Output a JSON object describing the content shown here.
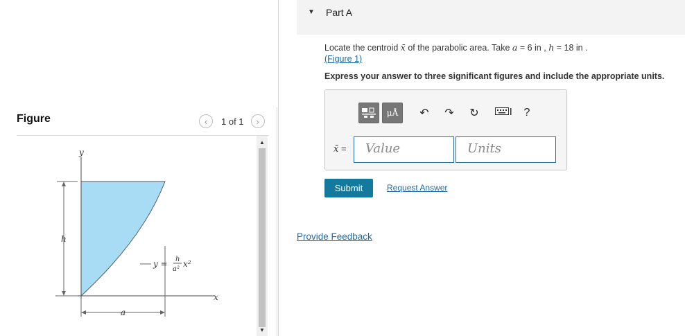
{
  "figure_panel": {
    "title": "Figure",
    "pager_text": "1 of 1",
    "labels": {
      "y_axis": "y",
      "x_axis": "x",
      "h": "h",
      "a": "a",
      "eq_y": "y =",
      "eq_h": "h",
      "eq_a2": "a²",
      "eq_x2": "x²"
    }
  },
  "part": {
    "title": "Part A"
  },
  "question": {
    "text_before": "Locate the centroid ",
    "xbar": "x̄",
    "text_mid": " of the parabolic area. Take ",
    "a_var": "a",
    "a_val": " = 6 in",
    "sep": " , ",
    "h_var": "h",
    "h_val": " = 18 in",
    "period": " .",
    "figure_link": "(Figure 1)",
    "instruction": "Express your answer to three significant figures and include the appropriate units."
  },
  "answer": {
    "label_var": "x̄",
    "label_eq": " =",
    "value_placeholder": "Value",
    "units_placeholder": "Units",
    "toolbar": {
      "units_btn": "μÅ",
      "help": "?"
    }
  },
  "actions": {
    "submit": "Submit",
    "request_answer": "Request Answer",
    "provide_feedback": "Provide Feedback"
  }
}
